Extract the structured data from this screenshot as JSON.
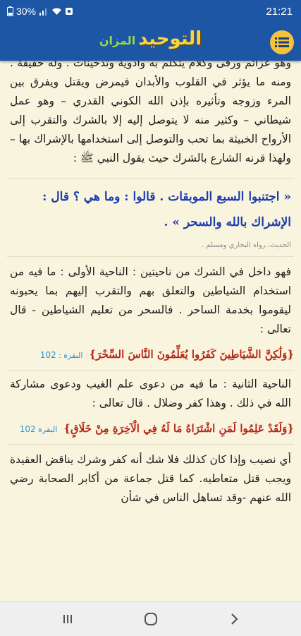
{
  "status": {
    "battery": "30%",
    "time": "21:21"
  },
  "appbar": {
    "title_main": "التوحيد",
    "title_sub": "المزان"
  },
  "content": {
    "para1": "وهو عزائم ورقى وكلام يتكلم به وأدوية وتدخينات . وله حقيقة . ومنه ما يؤثر في القلوب والأبدان فيمرض ويقتل ويفرق بين المرء وزوجه وتأثيره بإذن الله الكوني القدري – وهو عمل شيطاني – وكثير منه لا يتوصل إليه إلا بالشرك والتقرب إلى الأرواح الخبيثة بما تحب والتوصل إلى استخدامها بالإشراك بها – ولهذا قرنه الشارع بالشرك حيث يقول النبي ﷺ :",
    "hadith": "« اجتنبوا السبع الموبقات . قالوا : وما هي ؟ قال : الإشراك بالله والسحر » .",
    "hadith_source": "الحديث..رواه البخاري ومسلم .",
    "para2": "فهو داخل في الشرك من ناحيتين : الناحية الأولى : ما فيه من استخدام الشياطين والتعلق بهم والتقرب إليهم بما يحبونه ليقوموا بخدمة الساحر . فالسحر من تعليم الشياطين - قال تعالى :",
    "verse1": {
      "text": "{وَلَٰكِنَّ الشَّيَاطِينَ كَفَرُوا يُعَلِّمُونَ النَّاسَ السِّحْرَ}",
      "surah": "البقرة :",
      "ayah": "102"
    },
    "para3": "الناحية الثانية : ما فيه من دعوى علم الغيب ودعوى مشاركة الله في ذلك . وهذا كفر وضلال . قال تعالى :",
    "verse2": {
      "text": "{وَلَقَدْ عَلِمُوا لَمَنِ اشْتَرَاهُ مَا لَهُ فِي الْآخِرَةِ مِنْ خَلَاقٍ}",
      "surah": "البقرة",
      "ayah": "102"
    },
    "para4": "أي نصيب وإذا كان كذلك فلا شك أنه كفر وشرك يناقض العقيدة ويجب قتل متعاطيه. كما قتل جماعة من أكابر الصحابة رضي الله عنهم -وقد تساهل الناس في شأن"
  },
  "icons": {
    "menu": "menu-icon",
    "back": "back-icon",
    "home": "home-icon",
    "recents": "recents-icon"
  },
  "colors": {
    "appbar": "#1e56a6",
    "title": "#f7d548",
    "hadith": "#1a3cb0",
    "verse": "#b5291b",
    "reference": "#2a8fe0",
    "background": "#f9f4dd"
  }
}
